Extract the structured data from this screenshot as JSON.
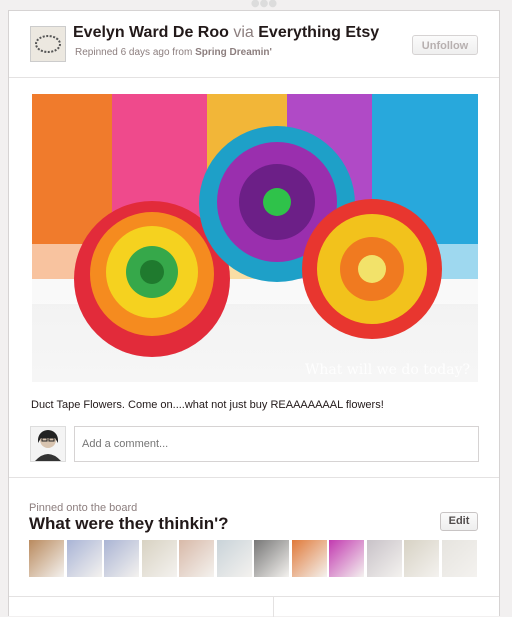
{
  "pinner": {
    "name": "Evelyn Ward De Roo",
    "via_word": "via",
    "via_user": "Everything Etsy",
    "repinned_text": "Repinned 6 days ago from",
    "source_board": "Spring Dreamin'"
  },
  "actions": {
    "unfollow_label": "Unfollow",
    "edit_label": "Edit"
  },
  "pin": {
    "description": "Duct Tape Flowers. Come on....what not just buy REAAAAAAAL flowers!",
    "image_watermark": "What will we do today?"
  },
  "comment": {
    "placeholder": "Add a comment..."
  },
  "board": {
    "pinned_label": "Pinned onto the board",
    "title": "What were they thinkin'?",
    "thumbnails": [
      {
        "icon": "boots-thumb",
        "color": "#b98a5e"
      },
      {
        "icon": "shoe-thumb",
        "color": "#a9b4d6"
      },
      {
        "icon": "shoe-thumb",
        "color": "#aab4d4"
      },
      {
        "icon": "sandal-thumb",
        "color": "#d8d2c2"
      },
      {
        "icon": "feet-thumb",
        "color": "#d8b9a8"
      },
      {
        "icon": "heels-thumb",
        "color": "#c9d3d9"
      },
      {
        "icon": "shoes-thumb",
        "color": "#777777"
      },
      {
        "icon": "cake-thumb",
        "color": "#e07a3a"
      },
      {
        "icon": "flower-thumb",
        "color": "#c23ab0"
      },
      {
        "icon": "baby-thumb",
        "color": "#c8c2c8"
      },
      {
        "icon": "lamp-thumb",
        "color": "#d7d2c4"
      },
      {
        "icon": "hanger-thumb",
        "color": "#e6e4df"
      }
    ]
  }
}
